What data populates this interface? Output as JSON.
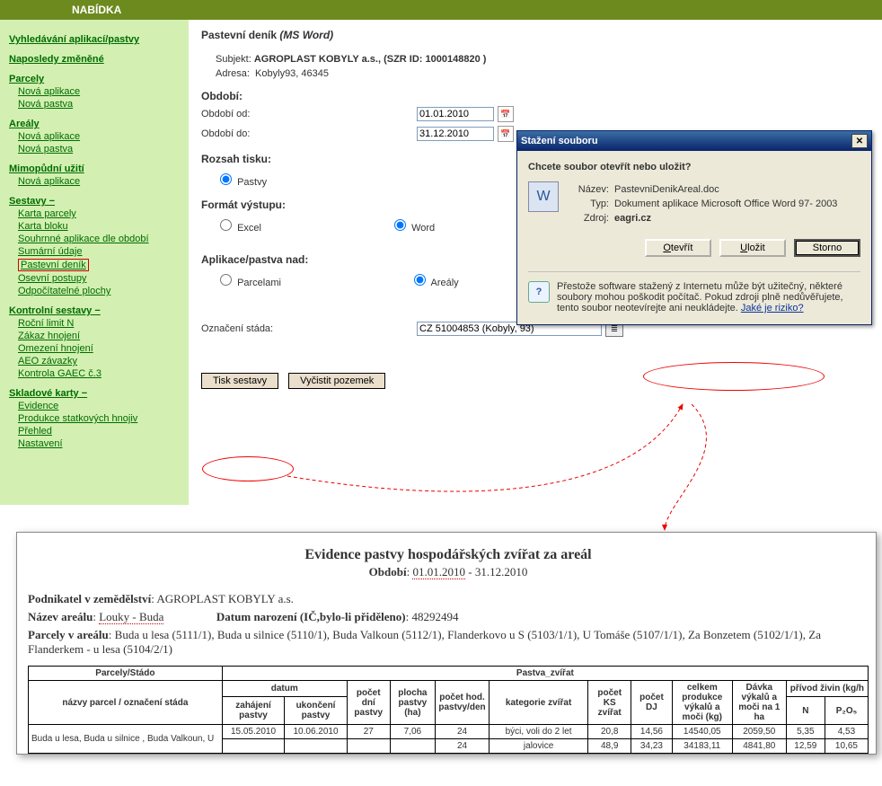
{
  "topbar": {
    "title": "NABÍDKA"
  },
  "sidebar": {
    "search": "Vyhledávání aplikací/pastvy",
    "recent": "Naposledy změněné",
    "parcely": {
      "head": "Parcely",
      "new_app": "Nová aplikace",
      "new_past": "Nová pastva"
    },
    "arealy": {
      "head": "Areály",
      "new_app": "Nová aplikace",
      "new_past": "Nová pastva"
    },
    "mimop": {
      "head": "Mimopůdní užití",
      "new_app": "Nová aplikace"
    },
    "sestavy": {
      "head": "Sestavy −",
      "items": [
        "Karta parcely",
        "Karta bloku",
        "Souhrnné aplikace dle období",
        "Sumární údaje",
        "Pastevní deník",
        "Osevní postupy",
        "Odpočítatelné plochy"
      ]
    },
    "kontrolni": {
      "head": "Kontrolní sestavy −",
      "items": [
        "Roční limit N",
        "Zákaz hnojení",
        "Omezení hnojení",
        "AEO závazky",
        "Kontrola GAEC č.3"
      ]
    },
    "sklad": {
      "head": "Skladové karty −",
      "items": [
        "Evidence",
        "Produkce statkových hnojiv",
        "Přehled",
        "Nastavení"
      ]
    }
  },
  "main": {
    "title": "Pastevní deník",
    "title_suffix": "(MS Word)",
    "subj_label": "Subjekt:",
    "subj_value": "AGROPLAST KOBYLY a.s., (SZR ID: 1000148820 )",
    "addr_label": "Adresa:",
    "addr_value": "Kobyly93, 46345",
    "period_head": "Období:",
    "period_from_lbl": "Období od:",
    "period_from_val": "01.01.2010",
    "period_to_lbl": "Období do:",
    "period_to_val": "31.12.2010",
    "rozsah_head": "Rozsah tisku:",
    "rozsah_opt": "Pastvy",
    "format_head": "Formát výstupu:",
    "format_excel": "Excel",
    "format_word": "Word",
    "apnad_head": "Aplikace/pastva nad:",
    "apnad_parc": "Parcelami",
    "apnad_areal": "Areály",
    "stado_lbl": "Označení stáda:",
    "stado_val": "CZ 51004853 (Kobyly, 93)",
    "btn_tisk": "Tisk sestavy",
    "btn_vyc": "Vyčistit pozemek"
  },
  "dialog": {
    "title": "Stažení souboru",
    "question": "Chcete soubor otevřít nebo uložit?",
    "name_lbl": "Název:",
    "name_val": "PastevniDenikAreal.doc",
    "type_lbl": "Typ:",
    "type_val": "Dokument aplikace Microsoft Office Word 97- 2003",
    "src_lbl": "Zdroj:",
    "src_val": "eagri.cz",
    "btn_open": "Otevřít",
    "btn_save": "Uložit",
    "btn_cancel": "Storno",
    "warn_text": "Přestože software stažený z Internetu může být užitečný, některé soubory mohou poškodit počítač. Pokud zdroji plně nedůvěřujete, tento soubor neotevírejte ani neukládejte.",
    "warn_link": "Jaké je riziko?"
  },
  "doc": {
    "title": "Evidence pastvy hospodářských zvířat za areál",
    "period_lbl": "Období",
    "period_from": "01.01.2010",
    "period_to": "31.12.2010",
    "podnik_lbl": "Podnikatel v zemědělství",
    "podnik_val": "AGROPLAST KOBYLY a.s.",
    "areal_lbl": "Název areálu",
    "areal_val": "Louky - Buda",
    "datnar_lbl": "Datum narození (IČ,bylo-li přiděleno)",
    "datnar_val": "48292494",
    "parc_lbl": "Parcely v areálu",
    "parc_val": "Buda u lesa (5111/1), Buda u silnice (5110/1), Buda Valkoun (5112/1), Flanderkovo u S (5103/1/1), U Tomáše (5107/1/1), Za Bonzetem (5102/1/1), Za Flanderkem - u lesa (5104/2/1)",
    "th": {
      "parcely_stado": "Parcely/Stádo",
      "nazvy": "názvy parcel / označení stáda",
      "pastva_zvirat": "Pastva_zvířat",
      "datum": "datum",
      "zahajeni": "zahájení pastvy",
      "ukonceni": "ukončení pastvy",
      "pocet_dni": "počet dní pastvy",
      "plocha": "plocha pastvy (ha)",
      "pocet_hod": "počet hod. pastvy/den",
      "kategorie": "kategorie zvířat",
      "pocet_ks": "počet KS zvířat",
      "pocet_dj": "počet DJ",
      "celkem_prod": "celkem produkce výkalů a moči (kg)",
      "davka": "Dávka výkalů a moči na 1 ha",
      "privod": "přívod živin (kg/h",
      "n": "N",
      "p2o5": "P₂O₅"
    },
    "rows": [
      {
        "nazvy": "Buda u lesa, Buda u silnice , Buda Valkoun, U",
        "zah": "15.05.2010",
        "uko": "10.06.2010",
        "dni": "27",
        "plo": "7,06",
        "hod": "24",
        "kat": "býci, voli do 2 let",
        "ks": "20,8",
        "dj": "14,56",
        "prod": "14540,05",
        "dav": "2059,50",
        "n": "5,35",
        "p": "4,53"
      },
      {
        "nazvy": "",
        "zah": "",
        "uko": "",
        "dni": "",
        "plo": "",
        "hod": "24",
        "kat": "jalovice",
        "ks": "48,9",
        "dj": "34,23",
        "prod": "34183,11",
        "dav": "4841,80",
        "n": "12,59",
        "p": "10,65"
      }
    ]
  }
}
